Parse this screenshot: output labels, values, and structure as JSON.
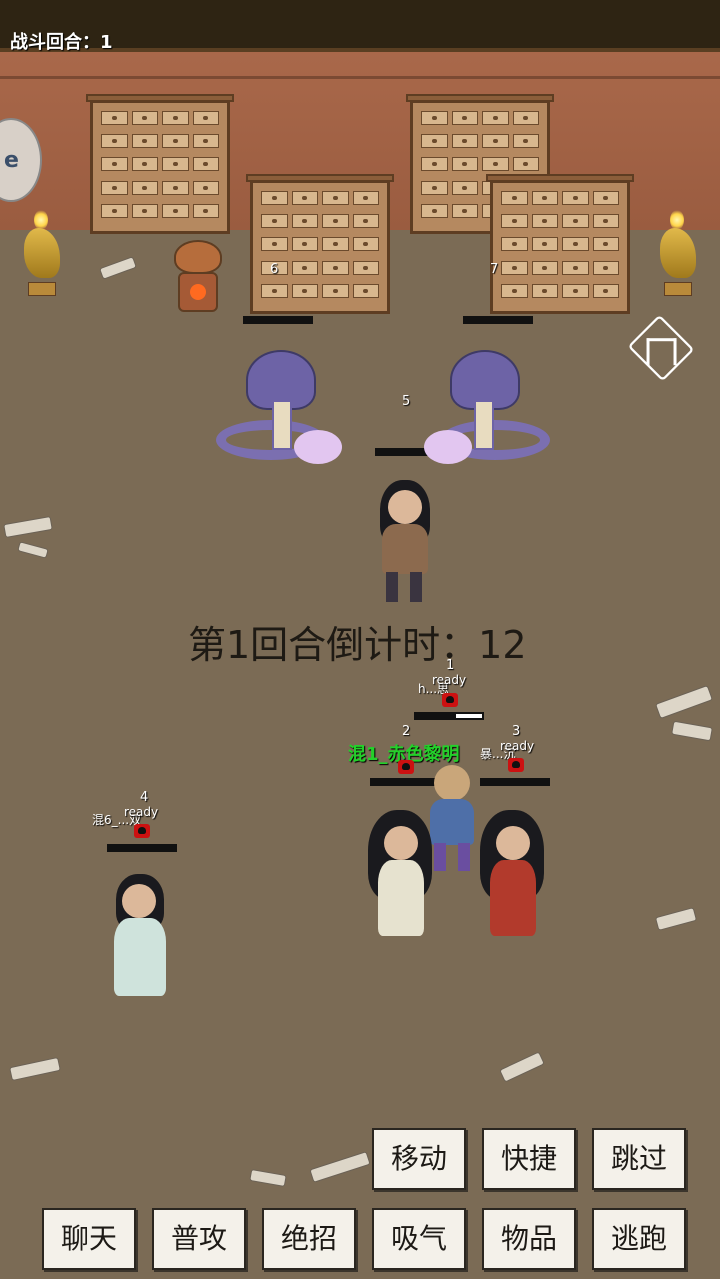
{
  "battle": {
    "round_label": "战斗回合：1",
    "countdown": "第1回合倒计时：12"
  },
  "side_icon": {
    "label": "e"
  },
  "enemies": [
    {
      "id": "6",
      "hp_fraction": 1.0
    },
    {
      "id": "7",
      "hp_fraction": 1.0
    },
    {
      "id": "5",
      "hp_fraction": 1.0
    }
  ],
  "allies": [
    {
      "id": "1",
      "status": "ready",
      "name": "h...思",
      "hp_fraction": 0.4
    },
    {
      "id": "2",
      "status": "",
      "name": "混1_赤色黎明",
      "hp_fraction": 1.0
    },
    {
      "id": "3",
      "status": "ready",
      "name": "暴...沉",
      "hp_fraction": 1.0
    },
    {
      "id": "4",
      "status": "ready",
      "name": "混6_...双",
      "hp_fraction": 1.0
    }
  ],
  "actions_top": [
    {
      "label": "移动"
    },
    {
      "label": "快捷"
    },
    {
      "label": "跳过"
    }
  ],
  "actions_bottom": [
    {
      "label": "聊天"
    },
    {
      "label": "普攻"
    },
    {
      "label": "绝招"
    },
    {
      "label": "吸气"
    },
    {
      "label": "物品"
    },
    {
      "label": "逃跑"
    }
  ],
  "colors": {
    "floor": "#7b6b55",
    "wall": "#a9684a",
    "player_name": "#23d12a",
    "enemy_marker": "#cc1111"
  },
  "icons": [
    "tower-icon",
    "skull-icon",
    "lamp-icon",
    "teapot-icon"
  ]
}
